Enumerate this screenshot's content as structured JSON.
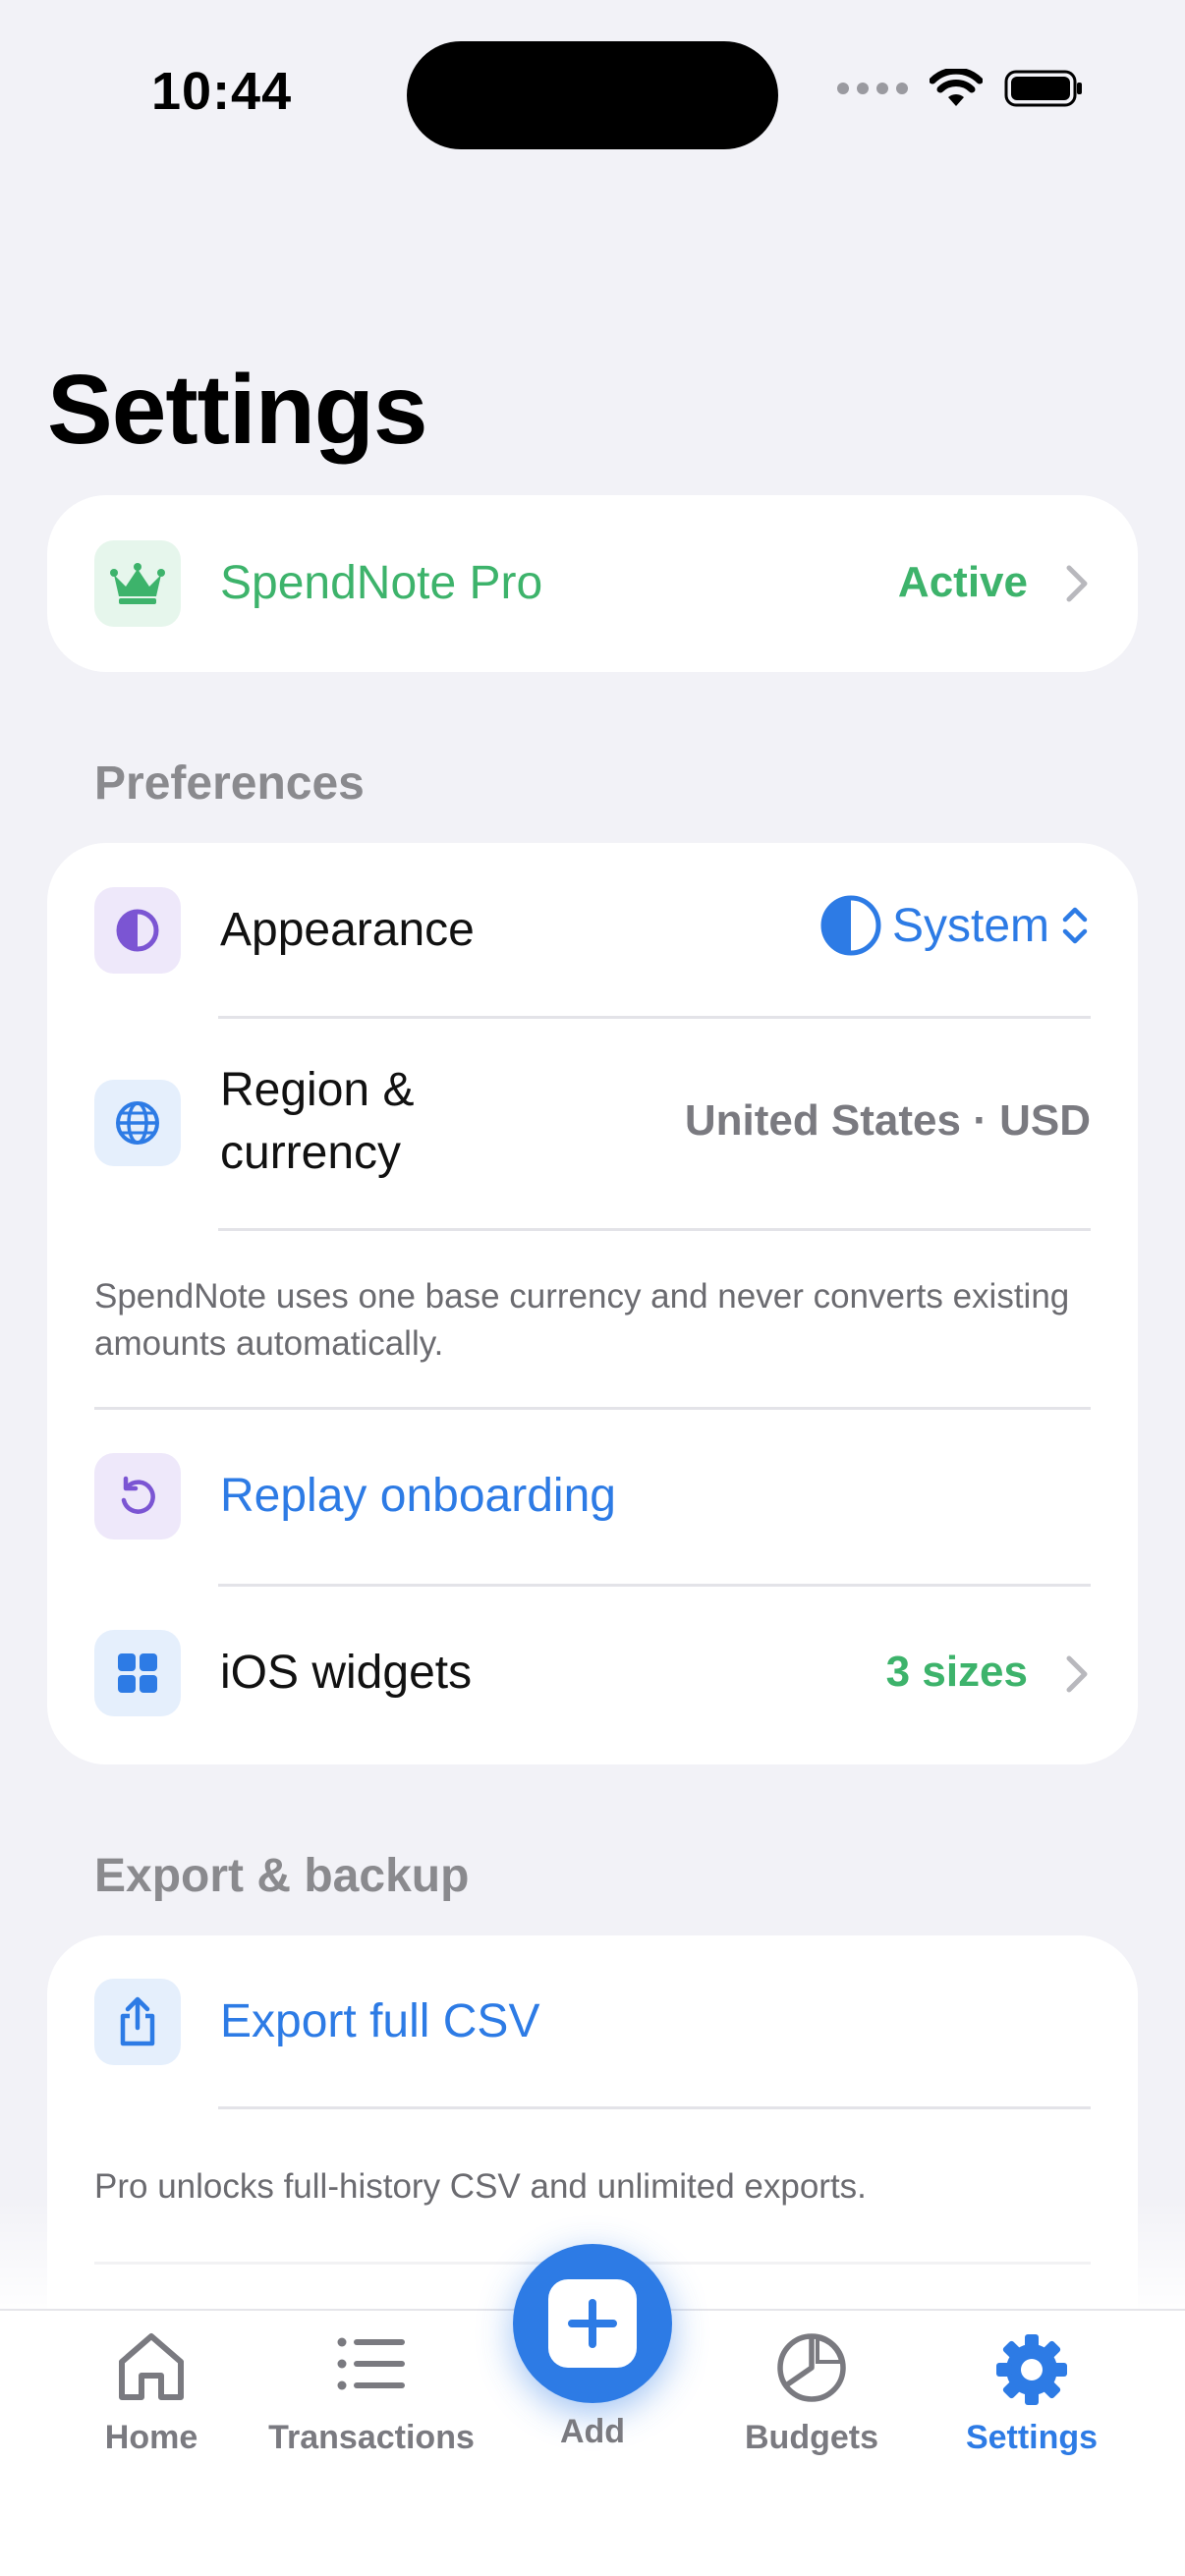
{
  "status_bar": {
    "time": "10:44"
  },
  "title": "Settings",
  "pro": {
    "label": "SpendNote Pro",
    "value": "Active",
    "icon": "crown-icon",
    "accent": "#3DB36B"
  },
  "preferences": {
    "header": "Preferences",
    "appearance": {
      "label": "Appearance",
      "value": "System",
      "icon": "contrast-icon"
    },
    "region": {
      "label_line1": "Region &",
      "label_line2": "currency",
      "value": "United States · USD",
      "icon": "globe-icon"
    },
    "region_note": "SpendNote uses one base currency and never converts existing amounts automatically.",
    "replay": {
      "label": "Replay onboarding",
      "icon": "replay-icon"
    },
    "widgets": {
      "label": "iOS widgets",
      "value": "3 sizes",
      "icon": "grid-icon"
    }
  },
  "export": {
    "header": "Export & backup",
    "csv": {
      "label": "Export full CSV",
      "icon": "share-icon"
    },
    "note": "Pro unlocks full-history CSV and unlimited exports."
  },
  "tabs": {
    "home": "Home",
    "transactions": "Transactions",
    "add": "Add",
    "budgets": "Budgets",
    "settings": "Settings"
  },
  "colors": {
    "blue": "#2D7BE5",
    "green": "#3DB36B",
    "purple": "#7B55D3",
    "gray": "#8A8A8E"
  }
}
